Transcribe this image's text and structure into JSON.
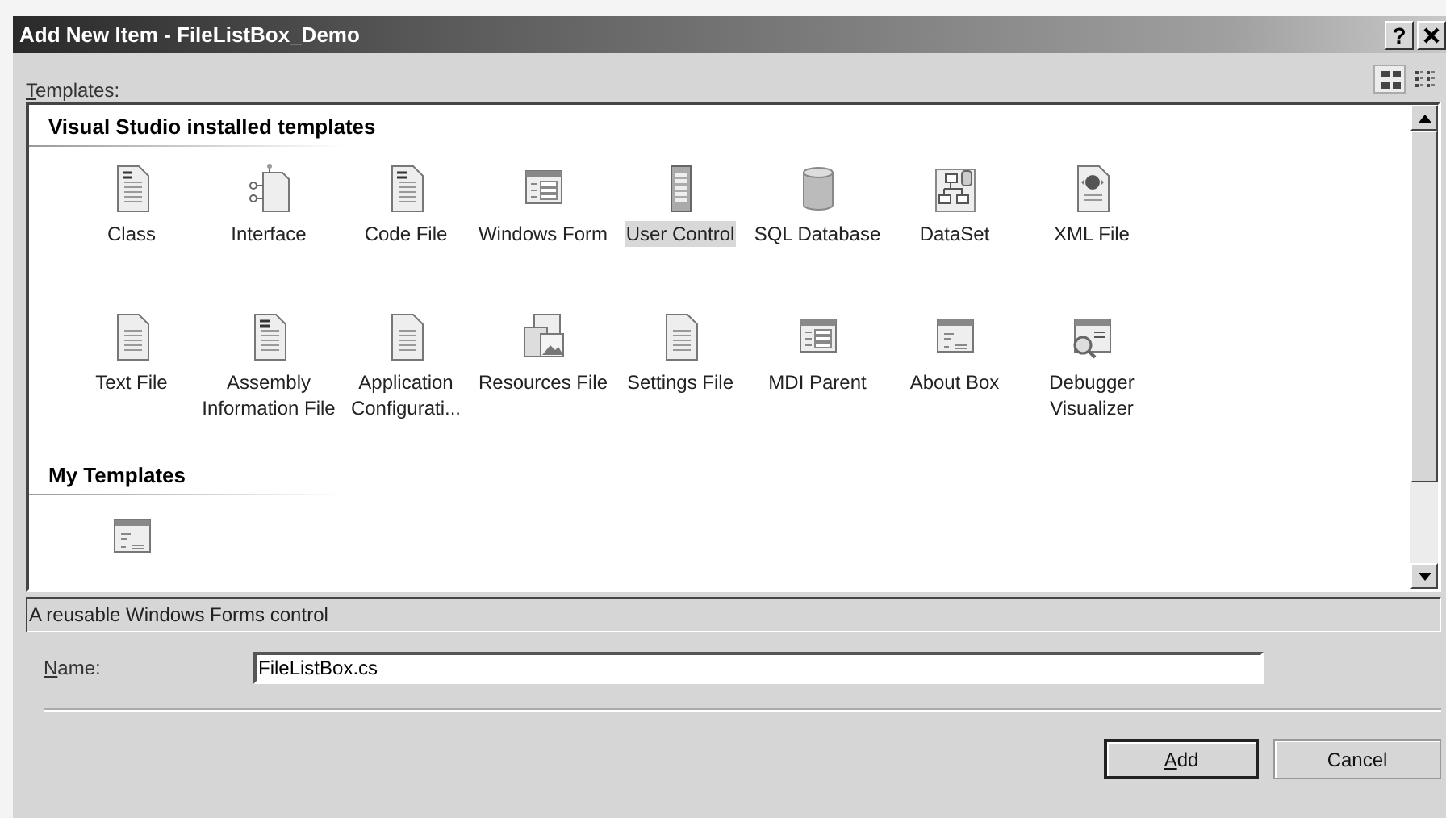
{
  "window": {
    "title": "Add New Item - FileListBox_Demo",
    "help": "?"
  },
  "templates_label": {
    "text": "Templates:",
    "mnemonic": true
  },
  "view_toggle": [
    {
      "kind": "large-icons",
      "selected": true
    },
    {
      "kind": "small-icons",
      "selected": false
    }
  ],
  "groups": [
    {
      "title": "Visual Studio installed templates",
      "items": [
        {
          "label": "Class",
          "kind": "code-document",
          "selected": false
        },
        {
          "label": "Interface",
          "kind": "interface",
          "selected": false
        },
        {
          "label": "Code File",
          "kind": "code-document",
          "selected": false
        },
        {
          "label": "Windows Form",
          "kind": "form",
          "selected": false
        },
        {
          "label": "User Control",
          "kind": "grid-control",
          "selected": true
        },
        {
          "label": "SQL Database",
          "kind": "cylinder",
          "selected": false
        },
        {
          "label": "DataSet",
          "kind": "diagram",
          "selected": false
        },
        {
          "label": "XML File",
          "kind": "globe-document",
          "selected": false
        },
        {
          "label": "Text File",
          "kind": "document",
          "selected": false
        },
        {
          "label": "Assembly Information File",
          "kind": "code-document",
          "selected": false
        },
        {
          "label": "Application Configurati...",
          "kind": "document",
          "selected": false
        },
        {
          "label": "Resources File",
          "kind": "window-picture",
          "selected": false
        },
        {
          "label": "Settings File",
          "kind": "document",
          "selected": false
        },
        {
          "label": "MDI Parent",
          "kind": "form",
          "selected": false
        },
        {
          "label": "About Box",
          "kind": "window",
          "selected": false
        },
        {
          "label": "Debugger Visualizer",
          "kind": "magnifier-window",
          "selected": false
        }
      ]
    },
    {
      "title": "My Templates",
      "items": [
        {
          "kind": "window",
          "selected": false
        }
      ]
    }
  ],
  "description": "A reusable Windows Forms control",
  "name_field": {
    "label": "Name:",
    "mnemonic": true,
    "value": "FileListBox.cs"
  },
  "buttons": [
    {
      "label": "Add",
      "mnemonic": true,
      "default": true
    },
    {
      "label": "Cancel",
      "mnemonic": false,
      "default": false
    }
  ]
}
